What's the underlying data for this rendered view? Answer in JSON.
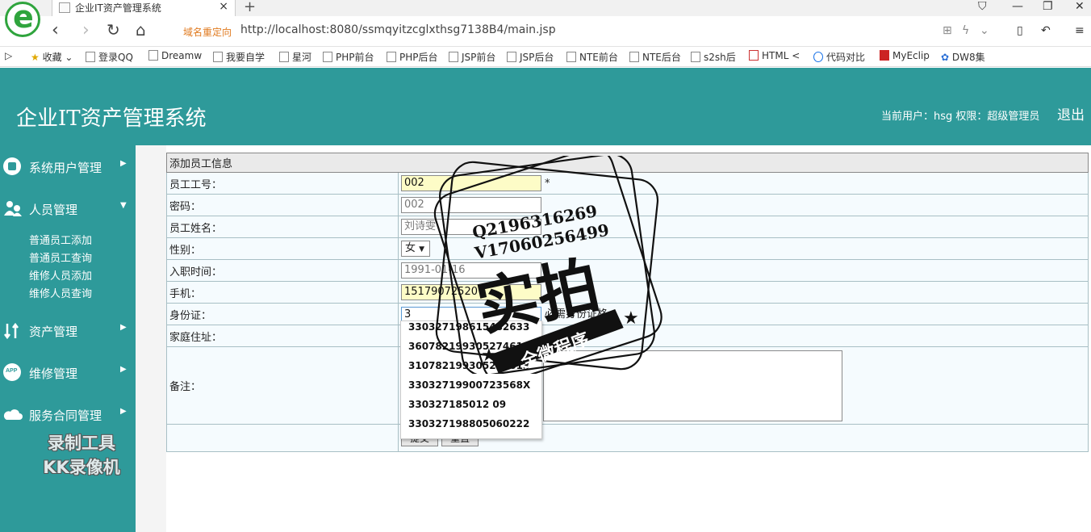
{
  "browser": {
    "logo_letter": "e",
    "tab_title": "企业IT资产管理系统",
    "tab_close": "×",
    "new_tab": "+",
    "redirect_label": "域名重定向",
    "url": "http://localhost:8080/ssmqyitzcglxthsg7138B4/main.jsp",
    "bookmarks": [
      "收藏",
      "登录QQ",
      "Dreamw",
      "我要自学",
      "星河",
      "PHP前台",
      "PHP后台",
      "JSP前台",
      "JSP后台",
      "NTE前台",
      "NTE后台",
      "s2sh后",
      "HTML <",
      "代码对比",
      "MyEclip",
      "DW8集"
    ]
  },
  "header": {
    "title": "企业IT资产管理系统",
    "user_info": "当前用户：hsg  权限：超级管理员",
    "logout": "退出"
  },
  "sidebar": {
    "menus": [
      {
        "label": "系统用户管理",
        "arrow": "▶"
      },
      {
        "label": "人员管理",
        "arrow": "▼"
      },
      {
        "label": "资产管理",
        "arrow": "▶"
      },
      {
        "label": "维修管理",
        "arrow": "▶"
      },
      {
        "label": "服务合同管理",
        "arrow": "▶"
      }
    ],
    "submenu": [
      "普通员工添加",
      "普通员工查询",
      "维修人员添加",
      "维修人员查询"
    ],
    "watermark_line1": "录制工具",
    "watermark_line2": "KK录像机"
  },
  "form": {
    "heading": "添加员工信息",
    "labels": {
      "emp_no": "员工工号：",
      "password": "密码：",
      "name": "员工姓名：",
      "gender": "性别：",
      "hire_date": "入职时间：",
      "phone": "手机：",
      "id_card": "身份证：",
      "address": "家庭住址：",
      "notes": "备注："
    },
    "values": {
      "emp_no": "002",
      "password": "002",
      "name": "刘诗雯",
      "gender": "女",
      "hire_date": "1991-01-16",
      "phone": "15179072520",
      "id_card": "3"
    },
    "required_mark": "*",
    "id_card_hint": "必需身份证格",
    "submit": "提交",
    "reset": "重置"
  },
  "autocomplete": [
    "330327198615482633",
    "360782199305274613",
    "310782199305274613",
    "33032719900723568X",
    "330327185012 09",
    "330327198805060222"
  ],
  "stamp": {
    "qq": "Q2196316269",
    "vx": "V17060256499",
    "main": "实拍",
    "ribbon": "全微程序"
  }
}
